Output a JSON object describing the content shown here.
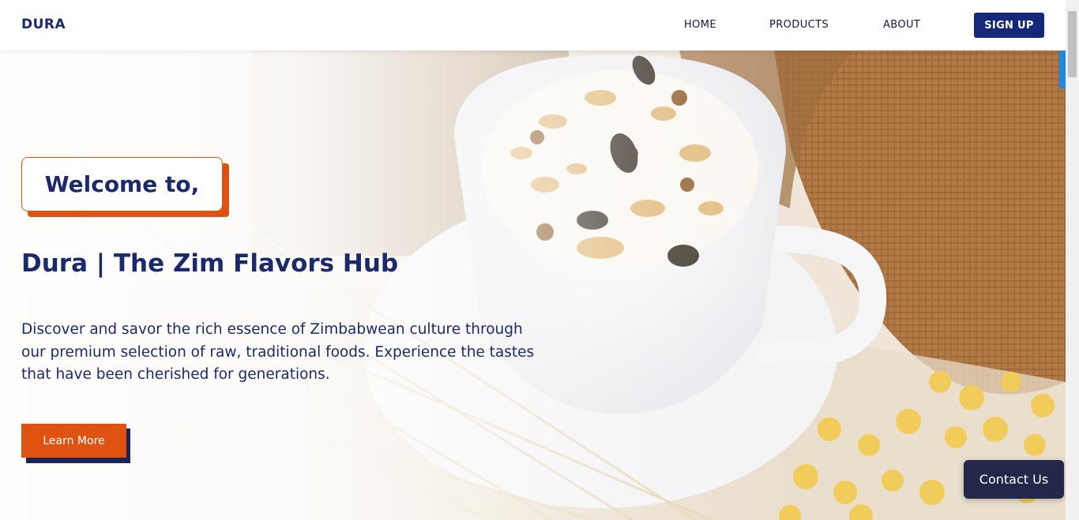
{
  "header": {
    "brand": "DURA",
    "nav": [
      "HOME",
      "PRODUCTS",
      "ABOUT"
    ],
    "signup_label": "SIGN UP"
  },
  "hero": {
    "welcome": "Welcome to,",
    "title": "Dura | The Zim Flavors Hub",
    "description": "Discover and savor the rich essence of Zimbabwean culture through our premium selection of raw, traditional foods. Experience the tastes that have been cherished for generations.",
    "cta_label": "Learn More"
  },
  "contact_label": "Contact Us",
  "colors": {
    "navy": "#1b2a6b",
    "accent_orange": "#e0520f",
    "button_navy": "#16287a",
    "contact_bg": "#23284a"
  }
}
